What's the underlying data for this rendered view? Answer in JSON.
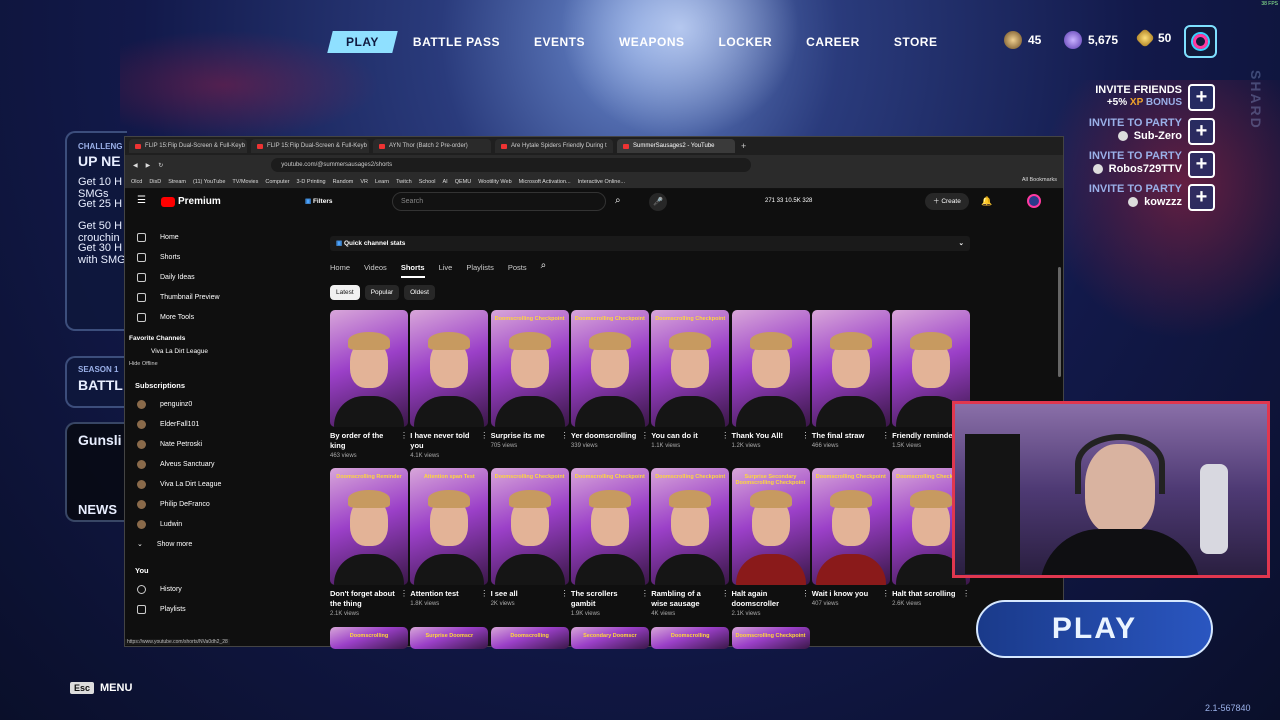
{
  "nav": {
    "items": [
      "PLAY",
      "BATTLE PASS",
      "EVENTS",
      "WEAPONS",
      "LOCKER",
      "CAREER",
      "STORE"
    ],
    "active": "PLAY"
  },
  "currency": {
    "level": "45",
    "vbucks": "5,675",
    "gold": "50"
  },
  "fps": "38 FPS",
  "left_panels": {
    "challenge_header": "CHALLENG",
    "challenge_sub": "UP NE",
    "challenges": [
      "Get 10 H\nSMGs",
      "Get 25 H",
      "Get 50 H\ncrouchin",
      "Get 30 H\nwith SMG"
    ],
    "season_header": "SEASON 1",
    "season_sub": "BATTL",
    "gunsli": "Gunsli",
    "news": "NEWS"
  },
  "invites": {
    "header": "INVITE FRIENDS",
    "bonus_prefix": "+5% ",
    "bonus_xp": "XP",
    "bonus_suffix": " BONUS",
    "party": [
      {
        "label": "INVITE TO PARTY",
        "name": "Sub-Zero"
      },
      {
        "label": "INVITE TO PARTY",
        "name": "Robos729TTV"
      },
      {
        "label": "INVITE TO PARTY",
        "name": "kowzzz"
      }
    ],
    "plus": "+"
  },
  "browser": {
    "tabs": [
      "FLIP 15:Flip Dual-Screen & Full-Keyb",
      "FLIP 15:Flip Dual-Screen & Full-Keyb",
      "AYN Thor (Batch 2 Pre-order)",
      "Are Hytale Spiders Friendly During t",
      "SummerSausages2 - YouTube"
    ],
    "url": "youtube.com/@summersausages2/shorts",
    "bookmarks": [
      "Olcd",
      "DisD",
      "Stream",
      "(11) YouTube",
      "TV/Movies",
      "Computer",
      "3-D Printing",
      "Random",
      "VR",
      "Learn",
      "Twitch",
      "School",
      "AI",
      "QEMU",
      "Wootility Web",
      "Microsoft Activation...",
      "Interactive Online..."
    ],
    "all_bookmarks": "All Bookmarks",
    "status_url": "https://www.youtube.com/shorts/NVa0dh2_28"
  },
  "youtube": {
    "logo": "Premium",
    "filters": "Filters",
    "search_placeholder": "Search",
    "stats": "271  33  10.5K  328",
    "create": "Create",
    "quick_stats": "Quick channel stats",
    "sidebar": [
      {
        "label": "Home",
        "icon": "home-icon"
      },
      {
        "label": "Shorts",
        "icon": "shorts-icon"
      },
      {
        "label": "Daily Ideas",
        "icon": "bulb-icon"
      },
      {
        "label": "Thumbnail Preview",
        "icon": "image-icon"
      },
      {
        "label": "More Tools",
        "icon": "tools-icon"
      }
    ],
    "favorite_header": "Favorite Channels",
    "favorite": "Viva La Dirt League",
    "hide_offline": "Hide Offline",
    "subs_header": "Subscriptions",
    "subs": [
      "penguinz0",
      "ElderFall101",
      "Nate Petroski",
      "Alveus Sanctuary",
      "Viva La Dirt League",
      "Philip DeFranco",
      "Ludwin"
    ],
    "show_more": "Show more",
    "you": "You",
    "history": "History",
    "playlists": "Playlists",
    "channel_tabs": [
      "Home",
      "Videos",
      "Shorts",
      "Live",
      "Playlists",
      "Posts"
    ],
    "active_tab": "Shorts",
    "sort": [
      "Latest",
      "Popular",
      "Oldest"
    ],
    "row1": [
      {
        "title": "By order of the king",
        "views": "463 views",
        "overlay": ""
      },
      {
        "title": "I have never told you",
        "views": "4.1K views",
        "overlay": ""
      },
      {
        "title": "Surprise its me",
        "views": "705 views",
        "overlay": "Doomscrolling Checkpoint"
      },
      {
        "title": "Yer doomscrolling",
        "views": "339 views",
        "overlay": "Doomscrolling Checkpoint"
      },
      {
        "title": "You can do it",
        "views": "1.1K views",
        "overlay": "Doomscrolling Checkpoint"
      },
      {
        "title": "Thank You All!",
        "views": "1.2K views",
        "overlay": ""
      },
      {
        "title": "The final straw",
        "views": "466 views",
        "overlay": ""
      },
      {
        "title": "Friendly reminder",
        "views": "1.5K views",
        "overlay": ""
      }
    ],
    "row2": [
      {
        "title": "Don't forget about the thing",
        "views": "2.1K views",
        "overlay": "Doomscrolling Reminder"
      },
      {
        "title": "Attention test",
        "views": "1.8K views",
        "overlay": "Attention span Test"
      },
      {
        "title": "I see all",
        "views": "2K views",
        "overlay": "Doomscrolling Checkpoint"
      },
      {
        "title": "The scrollers gambit",
        "views": "1.9K views",
        "overlay": "Doomscrolling Checkpoint"
      },
      {
        "title": "Rambling of a wise sausage",
        "views": "4K views",
        "overlay": "Doomscrolling Checkpoint"
      },
      {
        "title": "Halt again doomscroller",
        "views": "2.1K views",
        "overlay": "Surprise Secondary Doomscrolling Checkpoint"
      },
      {
        "title": "Wait i know you",
        "views": "407 views",
        "overlay": "Doomscrolling Checkpoint"
      },
      {
        "title": "Halt that scrolling",
        "views": "2.6K views",
        "overlay": "Doomscrolling Checkpoint"
      }
    ],
    "row3_overlays": [
      "Doomscrolling",
      "Surprise Doomscr",
      "Doomscrolling",
      "Secondary Doomscr",
      "Doomscrolling",
      "Doomscrolling Checkpoint"
    ]
  },
  "play_button": "PLAY",
  "esc": {
    "key": "Esc",
    "label": "MENU"
  },
  "version": "2.1-567840",
  "side_text_right": "SHARD"
}
